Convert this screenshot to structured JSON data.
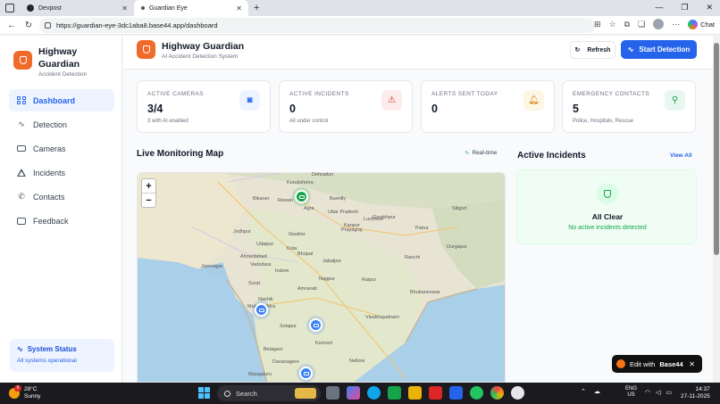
{
  "browser": {
    "tabs": [
      {
        "label": "Devpost"
      },
      {
        "label": "Guardian Eye"
      }
    ],
    "new_tab": "+",
    "url": "https://guardian-eye-3dc1aba8.base44.app/dashboard",
    "chat_label": "Chat",
    "window_controls": [
      "—",
      "❐",
      "✕"
    ]
  },
  "sidebar": {
    "brand_title": "Highway Guardian",
    "brand_subtitle": "Accident Detection",
    "items": [
      {
        "label": "Dashboard",
        "icon": "grid-icon",
        "active": true
      },
      {
        "label": "Detection",
        "icon": "activity-icon"
      },
      {
        "label": "Cameras",
        "icon": "camera-icon"
      },
      {
        "label": "Incidents",
        "icon": "alert-triangle-icon"
      },
      {
        "label": "Contacts",
        "icon": "phone-icon"
      },
      {
        "label": "Feedback",
        "icon": "message-icon"
      }
    ],
    "status": {
      "title": "System Status",
      "subtitle": "All systems operational"
    }
  },
  "header": {
    "title": "Highway Guardian",
    "subtitle": "AI Accident Detection System",
    "refresh_label": "Refresh",
    "start_label": "Start Detection"
  },
  "stats": [
    {
      "label": "ACTIVE CAMERAS",
      "value": "3/4",
      "note": "3 with AI enabled",
      "icon": "camera-icon",
      "icon_bg": "#eef4ff",
      "icon_color": "#2563eb"
    },
    {
      "label": "ACTIVE INCIDENTS",
      "value": "0",
      "note": "All under control",
      "icon": "alert-triangle-icon",
      "icon_bg": "#fdecec",
      "icon_color": "#dc2626"
    },
    {
      "label": "ALERTS SENT TODAY",
      "value": "0",
      "note": "",
      "icon": "bell-icon",
      "icon_bg": "#fef6e4",
      "icon_color": "#d97706"
    },
    {
      "label": "EMERGENCY CONTACTS",
      "value": "5",
      "note": "Police, Hospitals, Rescue",
      "icon": "map-pin-icon",
      "icon_bg": "#e8f7ef",
      "icon_color": "#16a34a"
    }
  ],
  "map_section": {
    "title": "Live Monitoring Map",
    "realtime_label": "Real-time",
    "zoom_in": "+",
    "zoom_out": "−",
    "cities": [
      "Dehradun",
      "Kurukshetra",
      "Rewari",
      "Agra",
      "Bareilly",
      "Lucknow",
      "Bikaner",
      "Jodhpur",
      "Gwalior",
      "Gorakhpur",
      "Siliguri",
      "Patna",
      "Kanpur",
      "Prayagraj",
      "Udaipur",
      "Kota",
      "Bhopal",
      "Jabalpur",
      "Ranchi",
      "Durgapur",
      "Ahmedabad",
      "Jamnagar",
      "Vadodara",
      "Indore",
      "Raipur",
      "Surat",
      "Nagpur",
      "Nashik",
      "Amravati",
      "Bhubaneswar",
      "Solapur",
      "Visakhapatnam",
      "Belagavi",
      "Kurnool",
      "Mangaluru",
      "Davanagere",
      "Nellore",
      "Maharashtra",
      "Uttar Pradesh"
    ]
  },
  "incidents_section": {
    "title": "Active Incidents",
    "view_all": "View All",
    "empty_title": "All Clear",
    "empty_subtitle": "No active incidents detected"
  },
  "base44_badge": {
    "label": "Edit with",
    "brand": "Base44",
    "close": "✕"
  },
  "taskbar": {
    "weather_temp": "28°C",
    "weather_desc": "Sunny",
    "weather_badge": "6",
    "search_placeholder": "Search",
    "lang": "ENG",
    "region": "US",
    "time": "14:37",
    "date": "27-11-2025"
  }
}
